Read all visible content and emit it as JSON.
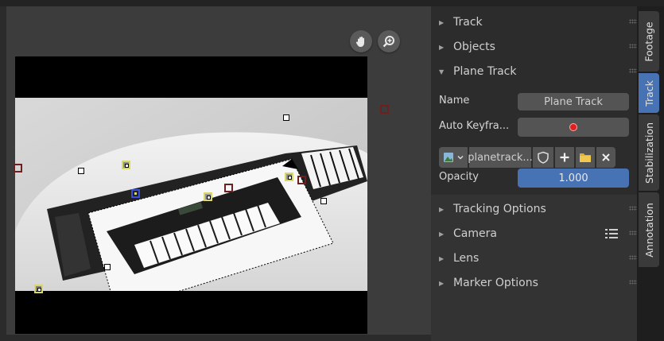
{
  "viewport": {
    "buttons": [
      {
        "name": "pan-hand-button",
        "icon": "hand-icon"
      },
      {
        "name": "zoom-button",
        "icon": "zoom-in-icon"
      }
    ]
  },
  "sidebar": {
    "sections_top": [
      {
        "label": "Track",
        "expanded": false
      },
      {
        "label": "Objects",
        "expanded": false
      },
      {
        "label": "Plane Track",
        "expanded": true
      }
    ],
    "plane_track": {
      "name_label": "Name",
      "name_value": "Plane Track",
      "auto_keyframe_label": "Auto Keyfra...",
      "auto_keyframe_icon": "record-dot-icon",
      "image_name": "planetrack...",
      "image_icons": [
        "image-icon",
        "chevron-down-icon",
        "shield-icon",
        "plus-icon",
        "folder-icon",
        "close-icon"
      ],
      "opacity_label": "Opacity",
      "opacity_value": "1.000"
    },
    "sections_bottom": [
      {
        "label": "Tracking Options"
      },
      {
        "label": "Camera"
      },
      {
        "label": "Lens"
      },
      {
        "label": "Marker Options"
      }
    ],
    "camera_icon": "list-icon"
  },
  "tabs": [
    {
      "label": "Footage",
      "active": false
    },
    {
      "label": "Track",
      "active": true
    },
    {
      "label": "Stabilization",
      "active": false
    },
    {
      "label": "Annotation",
      "active": false
    }
  ],
  "colors": {
    "accent": "#4772b3",
    "record": "#e02020",
    "marker_red": "#6e1f1f",
    "marker_yellow": "#d8d86a"
  }
}
